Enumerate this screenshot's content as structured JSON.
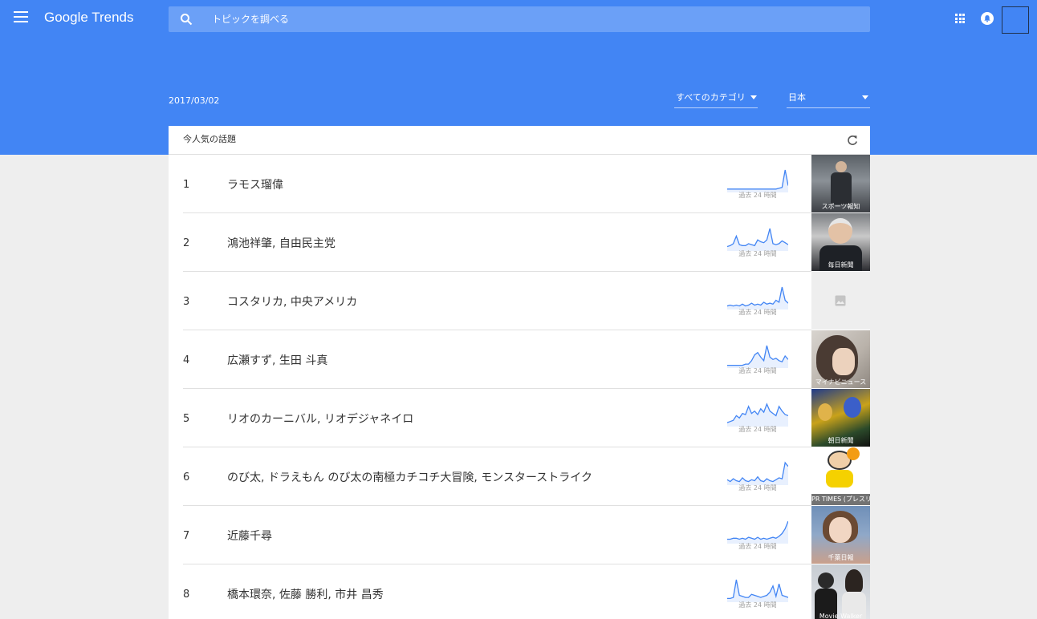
{
  "header": {
    "logo_text": "Google Trends",
    "search_placeholder": "トピックを調べる",
    "menu_icon": "hamburger-menu-icon",
    "apps_icon": "apps-grid-icon",
    "notifications_icon": "bell-icon"
  },
  "colors": {
    "brand_blue": "#4285f4",
    "search_bg": "#6ba0f7",
    "page_bg": "#eeeeee",
    "sparkline": "#4285f4"
  },
  "date": "2017/03/02",
  "filters": {
    "category": "すべてのカテゴリ",
    "region": "日本"
  },
  "card": {
    "title": "今人気の話題",
    "refresh_icon": "refresh-icon"
  },
  "stories": [
    {
      "rank": "1",
      "title": "ラモス瑠偉",
      "spark_label": "過去 24 時間",
      "source": "スポーツ報知",
      "trend": [
        2,
        2,
        2,
        2,
        2,
        2,
        2,
        2,
        2,
        2,
        2,
        2,
        2,
        2,
        2,
        2,
        2,
        3,
        4,
        24,
        6
      ]
    },
    {
      "rank": "2",
      "title": "鴻池祥肇, 自由民主党",
      "spark_label": "過去 24 時間",
      "source": "毎日新聞",
      "trend": [
        3,
        4,
        6,
        14,
        5,
        4,
        4,
        6,
        5,
        4,
        10,
        8,
        7,
        10,
        22,
        6,
        5,
        6,
        9,
        7,
        5
      ]
    },
    {
      "rank": "3",
      "title": "コスタリカ, 中央アメリカ",
      "spark_label": "過去 24 時間",
      "source": "",
      "trend": [
        2,
        3,
        2,
        3,
        2,
        4,
        2,
        3,
        5,
        3,
        4,
        3,
        6,
        4,
        5,
        4,
        8,
        6,
        22,
        8,
        5
      ]
    },
    {
      "rank": "4",
      "title": "広瀬すず, 生田 斗真",
      "spark_label": "過去 24 時間",
      "source": "マイナビニュース",
      "trend": [
        1,
        1,
        1,
        1,
        1,
        1,
        2,
        2,
        5,
        10,
        12,
        8,
        5,
        18,
        8,
        6,
        7,
        5,
        4,
        9,
        6
      ]
    },
    {
      "rank": "5",
      "title": "リオのカーニバル, リオデジャネイロ",
      "spark_label": "過去 24 時間",
      "source": "朝日新聞",
      "trend": [
        2,
        3,
        4,
        8,
        6,
        10,
        9,
        16,
        10,
        12,
        9,
        14,
        11,
        18,
        12,
        10,
        8,
        16,
        12,
        9,
        8
      ]
    },
    {
      "rank": "6",
      "title": "のび太, ドラえもん のび太の南極カチコチ大冒険, モンスターストライク",
      "spark_label": "過去 24 時間",
      "source": "PR TIMES (プレスリリース)",
      "trend": [
        4,
        2,
        5,
        3,
        2,
        6,
        3,
        2,
        4,
        3,
        7,
        3,
        2,
        5,
        3,
        2,
        4,
        6,
        5,
        22,
        18
      ]
    },
    {
      "rank": "7",
      "title": "近藤千尋",
      "spark_label": "過去 24 時間",
      "source": "千葉日報",
      "trend": [
        3,
        3,
        4,
        4,
        3,
        4,
        3,
        5,
        4,
        3,
        5,
        3,
        4,
        3,
        4,
        5,
        4,
        6,
        9,
        14,
        22
      ]
    },
    {
      "rank": "8",
      "title": "橋本環奈, 佐藤 勝利, 市井 昌秀",
      "spark_label": "過去 24 時間",
      "source": "Movie Walker",
      "trend": [
        2,
        2,
        3,
        20,
        5,
        4,
        3,
        3,
        6,
        5,
        4,
        3,
        4,
        5,
        8,
        14,
        4,
        16,
        5,
        4,
        3
      ]
    }
  ]
}
